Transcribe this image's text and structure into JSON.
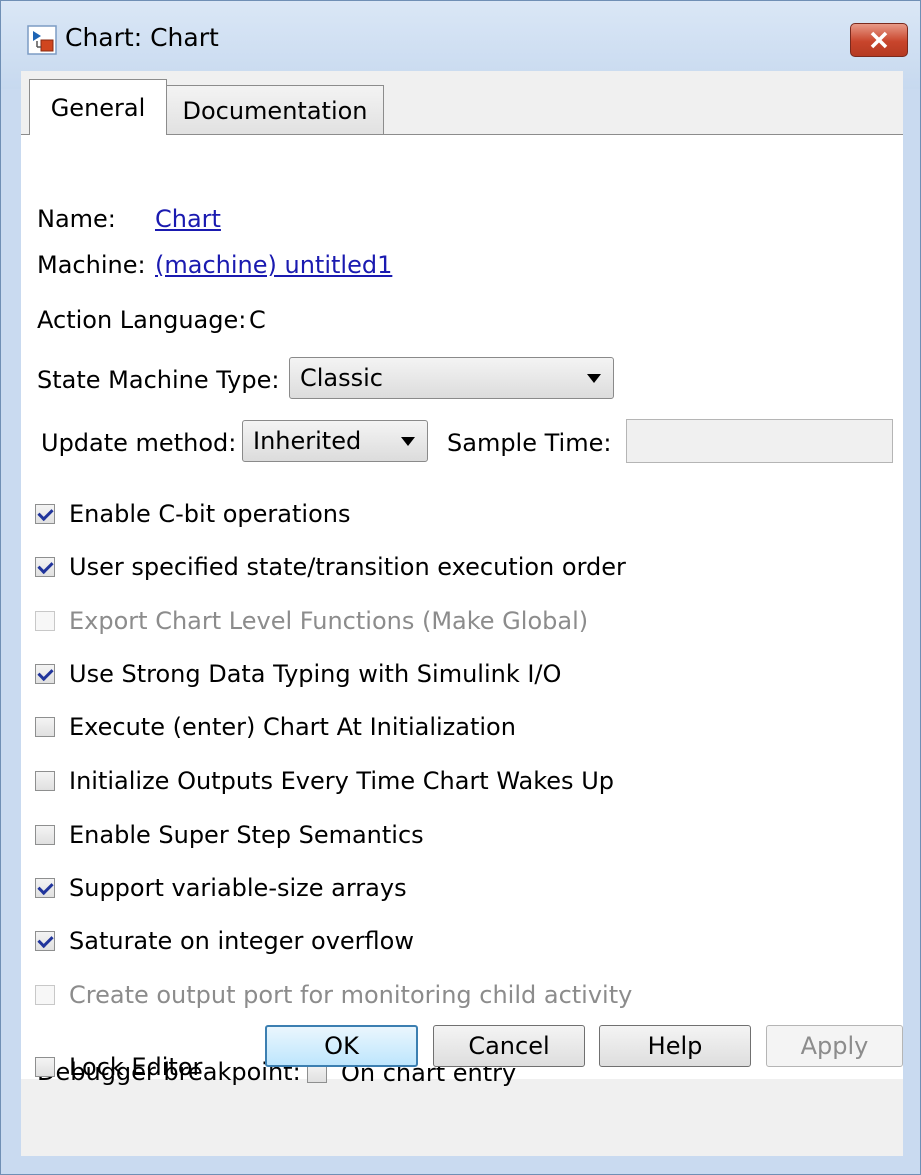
{
  "window": {
    "title": "Chart: Chart"
  },
  "tabs": [
    {
      "label": "General"
    },
    {
      "label": "Documentation"
    }
  ],
  "general": {
    "name_label": "Name:",
    "name_value": "Chart",
    "machine_label": "Machine:",
    "machine_value": "(machine) untitled1",
    "action_language_label": "Action Language:",
    "action_language_value": "C",
    "state_machine_type_label": "State Machine Type:",
    "state_machine_type_value": "Classic",
    "update_method_label": "Update method:",
    "update_method_value": "Inherited",
    "sample_time_label": "Sample Time:",
    "sample_time_value": "",
    "checkboxes": [
      {
        "label": "Enable C-bit operations",
        "checked": true,
        "enabled": true
      },
      {
        "label": "User specified state/transition execution order",
        "checked": true,
        "enabled": true
      },
      {
        "label": "Export Chart Level Functions (Make Global)",
        "checked": false,
        "enabled": false
      },
      {
        "label": "Use Strong Data Typing with Simulink I/O",
        "checked": true,
        "enabled": true
      },
      {
        "label": "Execute (enter) Chart At Initialization",
        "checked": false,
        "enabled": true
      },
      {
        "label": "Initialize Outputs Every Time Chart Wakes Up",
        "checked": false,
        "enabled": true
      },
      {
        "label": "Enable Super Step Semantics",
        "checked": false,
        "enabled": true
      },
      {
        "label": "Support variable-size arrays",
        "checked": true,
        "enabled": true
      },
      {
        "label": "Saturate on integer overflow",
        "checked": true,
        "enabled": true
      },
      {
        "label": "Create output port for monitoring child activity",
        "checked": false,
        "enabled": false
      }
    ],
    "debugger_label": "Debugger breakpoint:",
    "debugger_checkbox": {
      "label": "On chart entry",
      "checked": false
    },
    "lock_editor": {
      "label": "Lock Editor",
      "checked": false
    }
  },
  "buttons": {
    "ok": "OK",
    "cancel": "Cancel",
    "help": "Help",
    "apply": "Apply"
  }
}
